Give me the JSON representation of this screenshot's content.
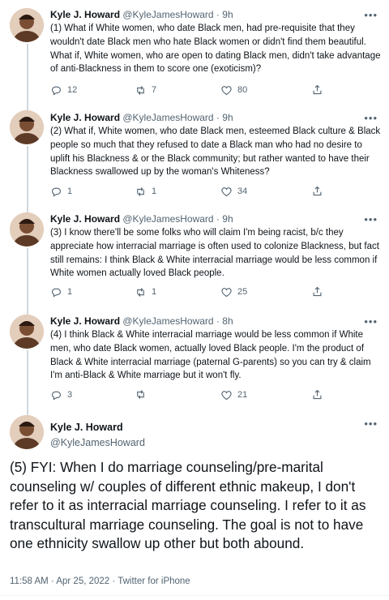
{
  "tweets": [
    {
      "name": "Kyle J. Howard",
      "handle": "@KyleJamesHoward",
      "sep": " · ",
      "time": "9h",
      "text": "(1) What if White women, who date Black men, had pre-requisite that they wouldn't date Black men who hate Black women or didn't find them beautiful. What if, White women, who are open to dating Black men, didn't take advantage of anti-Blackness in them to score one (exoticism)?",
      "replies": "12",
      "retweets": "7",
      "likes": "80",
      "share": ""
    },
    {
      "name": "Kyle J. Howard",
      "handle": "@KyleJamesHoward",
      "sep": " · ",
      "time": "9h",
      "text": "(2) What if, White women, who date Black men, esteemed Black culture & Black people so much that they refused to date a Black man who had no desire to uplift his Blackness & or the Black community; but rather wanted to have their Blackness swallowed up by the woman's Whiteness?",
      "replies": "1",
      "retweets": "1",
      "likes": "34",
      "share": ""
    },
    {
      "name": "Kyle J. Howard",
      "handle": "@KyleJamesHoward",
      "sep": " · ",
      "time": "9h",
      "text": "(3) I know there'll be some folks who will claim I'm being racist, b/c they appreciate how interracial marriage is often used to colonize Blackness, but fact still remains: I think Black & White interracial marriage would be less common if White women actually loved Black people.",
      "replies": "1",
      "retweets": "1",
      "likes": "25",
      "share": ""
    },
    {
      "name": "Kyle J. Howard",
      "handle": "@KyleJamesHoward",
      "sep": " · ",
      "time": "8h",
      "text": "(4) I think Black & White interracial marriage would be less common if White men, who date Black women, actually loved Black people. I'm the product of Black & White interracial marriage (paternal G-parents) so you can try & claim I'm anti-Black & White marriage but it won't fly.",
      "replies": "3",
      "retweets": "",
      "likes": "21",
      "share": ""
    }
  ],
  "main": {
    "name": "Kyle J. Howard",
    "handle": "@KyleJamesHoward",
    "text": "(5) FYI: When I do marriage counseling/pre-marital counseling w/ couples of different ethnic makeup, I don't refer to it as interracial marriage counseling. I refer to it as transcultural marriage counseling. The goal is not to have one ethnicity swallow up other but both abound.",
    "time": "11:58 AM",
    "date": "Apr 25, 2022",
    "source": "Twitter for iPhone",
    "sep": " · "
  },
  "icons": {
    "more": "more-dots-icon",
    "reply": "reply-icon",
    "retweet": "retweet-icon",
    "like": "heart-icon",
    "share": "share-icon"
  },
  "colors": {
    "text": "#0f1419",
    "secondary": "#536471",
    "thread_line": "#cfd9de"
  }
}
